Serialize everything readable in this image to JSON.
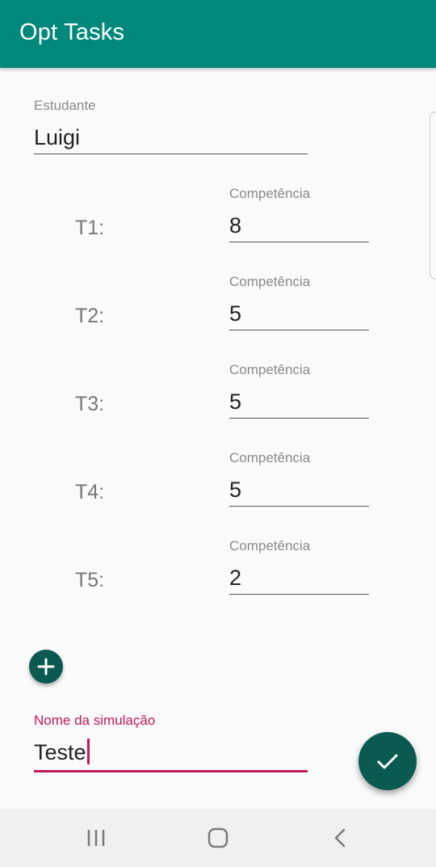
{
  "app": {
    "title": "Opt Tasks",
    "accent_color": "#00897b",
    "fab_color": "#0b5a52",
    "focus_color": "#c2185b"
  },
  "student": {
    "label": "Estudante",
    "value": "Luigi"
  },
  "tasks": [
    {
      "label": "T1:",
      "field_label": "Competência",
      "value": "8"
    },
    {
      "label": "T2:",
      "field_label": "Competência",
      "value": "5"
    },
    {
      "label": "T3:",
      "field_label": "Competência",
      "value": "5"
    },
    {
      "label": "T4:",
      "field_label": "Competência",
      "value": "5"
    },
    {
      "label": "T5:",
      "field_label": "Competência",
      "value": "2"
    }
  ],
  "add_button": {
    "icon": "plus-icon"
  },
  "simulation": {
    "label": "Nome da simulação",
    "value": "Teste"
  },
  "save_button": {
    "icon": "check-icon"
  },
  "navbar": {
    "icons": [
      "recent-apps-icon",
      "home-icon",
      "back-icon"
    ]
  }
}
